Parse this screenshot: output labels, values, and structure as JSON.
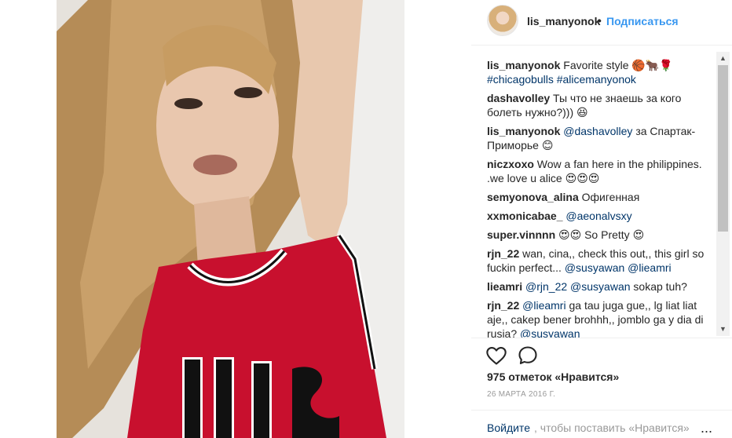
{
  "header": {
    "username": "lis_manyonok",
    "dot": "•",
    "follow_label": "Подписаться"
  },
  "comments": [
    {
      "user": "lis_manyonok",
      "text": "Favorite style 🏀🐂🌹",
      "mentions": "#chicagobulls #alicemanyonok",
      "after": ""
    },
    {
      "user": "dashavolley",
      "text": "Ты что не знаешь за кого болеть нужно?))) 😆",
      "mentions": "",
      "after": ""
    },
    {
      "user": "lis_manyonok",
      "text": "",
      "mentions": "@dashavolley",
      "after": "за Спартак-Приморье 😊"
    },
    {
      "user": "niczxoxo",
      "text": "Wow a fan here in the philippines. .we love u alice 😍😍😍",
      "mentions": "",
      "after": ""
    },
    {
      "user": "semyonova_alina",
      "text": "Офигенная",
      "mentions": "",
      "after": ""
    },
    {
      "user": "xxmonicabae_",
      "text": "",
      "mentions": "@aeonalvsxy",
      "after": ""
    },
    {
      "user": "super.vinnnn",
      "text": "😍😍 So Pretty 😍",
      "mentions": "",
      "after": ""
    },
    {
      "user": "rjn_22",
      "text": "wan, cina,, check this out,, this girl so fuckin perfect...",
      "mentions": "@susyawan @lieamri",
      "after": ""
    },
    {
      "user": "lieamri",
      "text": "",
      "mentions": "@rjn_22 @susyawan",
      "after": "sokap tuh?"
    },
    {
      "user": "rjn_22",
      "text": "",
      "mentions": "@lieamri",
      "after": "ga tau juga gue,, lg liat liat aje,, cakep bener brohhh,, jomblo ga y dia di rusia?",
      "tail": "@susyawan"
    }
  ],
  "likes_text": "975 отметок «Нравится»",
  "date_text": "26 МАРТА 2016 Г.",
  "add_comment": {
    "login": "Войдите",
    "rest": ", чтобы поставить «Нравится»",
    "more": "..."
  },
  "icons": {
    "heart": "heart-icon",
    "comment": "comment-icon",
    "scroll_up": "scroll-up-icon",
    "scroll_down": "scroll-down-icon"
  },
  "colors": {
    "link": "#003569",
    "follow": "#3897f0",
    "muted": "#999999"
  }
}
